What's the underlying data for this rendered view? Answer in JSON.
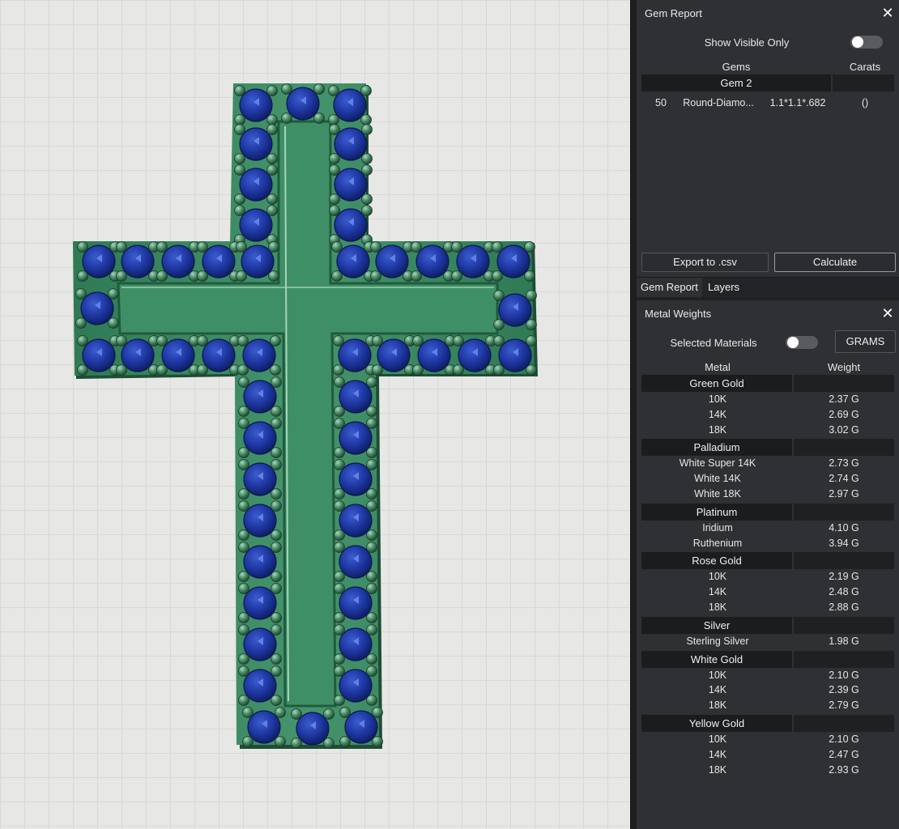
{
  "gem_report": {
    "title": "Gem Report",
    "show_visible_only_label": "Show Visible Only",
    "col_gems": "Gems",
    "col_carats": "Carats",
    "group_name": "Gem 2",
    "row": {
      "count": "50",
      "name": "Round-Diamo...",
      "size": "1.1*1.1*.682",
      "carats": "()"
    },
    "export_label": "Export to .csv",
    "calculate_label": "Calculate"
  },
  "tabs": [
    "Gem Report",
    "Layers"
  ],
  "metal_weights": {
    "title": "Metal Weights",
    "selected_materials_label": "Selected Materials",
    "units_button": "GRAMS",
    "col_metal": "Metal",
    "col_weight": "Weight",
    "groups": [
      {
        "name": "Green Gold",
        "rows": [
          [
            "10K",
            "2.37 G"
          ],
          [
            "14K",
            "2.69 G"
          ],
          [
            "18K",
            "3.02 G"
          ]
        ]
      },
      {
        "name": "Palladium",
        "rows": [
          [
            "White Super 14K",
            "2.73 G"
          ],
          [
            "White 14K",
            "2.74 G"
          ],
          [
            "White 18K",
            "2.97 G"
          ]
        ]
      },
      {
        "name": "Platinum",
        "rows": [
          [
            "Iridium",
            "4.10 G"
          ],
          [
            "Ruthenium",
            "3.94 G"
          ]
        ]
      },
      {
        "name": "Rose Gold",
        "rows": [
          [
            "10K",
            "2.19 G"
          ],
          [
            "14K",
            "2.48 G"
          ],
          [
            "18K",
            "2.88 G"
          ]
        ]
      },
      {
        "name": "Silver",
        "rows": [
          [
            "Sterling Silver",
            "1.98 G"
          ]
        ]
      },
      {
        "name": "White Gold",
        "rows": [
          [
            "10K",
            "2.10 G"
          ],
          [
            "14K",
            "2.39 G"
          ],
          [
            "18K",
            "2.79 G"
          ]
        ]
      },
      {
        "name": "Yellow Gold",
        "rows": [
          [
            "10K",
            "2.10 G"
          ],
          [
            "14K",
            "2.47 G"
          ],
          [
            "18K",
            "2.93 G"
          ]
        ]
      }
    ]
  },
  "colors": {
    "metal": "#3c8a63",
    "gem": "#1f3a9c",
    "panel": "#2f3033"
  }
}
